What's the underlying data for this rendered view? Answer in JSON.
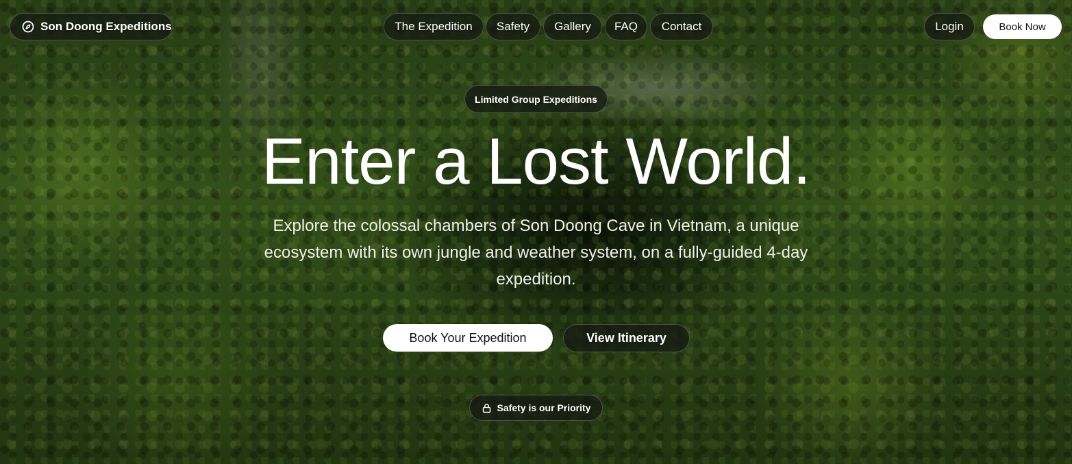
{
  "brand": {
    "name": "Son Doong Expeditions",
    "icon": "compass-icon"
  },
  "nav": {
    "items": [
      {
        "label": "The Expedition"
      },
      {
        "label": "Safety"
      },
      {
        "label": "Gallery"
      },
      {
        "label": "FAQ"
      },
      {
        "label": "Contact"
      }
    ]
  },
  "header_actions": {
    "login_label": "Login",
    "book_now_label": "Book Now"
  },
  "hero": {
    "badge": "Limited Group Expeditions",
    "headline": "Enter a Lost World.",
    "subtitle": "Explore the colossal chambers of Son Doong Cave in Vietnam, a unique ecosystem with its own jungle and weather system, on a fully-guided 4-day expedition.",
    "primary_cta": "Book Your Expedition",
    "secondary_cta": "View Itinerary",
    "safety_badge": "Safety is our Priority",
    "safety_icon": "lock-icon"
  },
  "colors": {
    "pill_background": "#16191a",
    "primary_button": "#ffffff",
    "text": "#ffffff",
    "background": "#3a5a1d"
  }
}
